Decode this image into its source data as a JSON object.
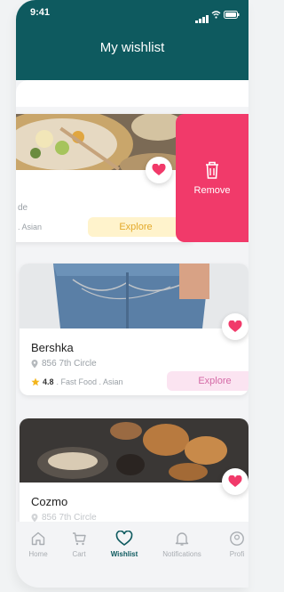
{
  "status_bar": {
    "time": "9:41"
  },
  "header": {
    "title": "My wishlist"
  },
  "cards": [
    {
      "name_partial": "de",
      "meta_partial": ". Asian",
      "explore_label": "Explore",
      "remove_label": "Remove"
    },
    {
      "name": "Bershka",
      "address": "856 7th Circle",
      "rating": "4.8",
      "categories": ". Fast Food . Asian",
      "explore_label": "Explore"
    },
    {
      "name": "Cozmo",
      "address": "856 7th Circle"
    }
  ],
  "nav": {
    "items": [
      {
        "label": "Home",
        "icon": "home-icon"
      },
      {
        "label": "Cart",
        "icon": "cart-icon"
      },
      {
        "label": "Wishlist",
        "icon": "heart-outline-icon",
        "active": true
      },
      {
        "label": "Notifications",
        "icon": "bell-icon"
      },
      {
        "label": "Profi",
        "icon": "profile-icon"
      }
    ]
  },
  "colors": {
    "header": "#0e5a5f",
    "accent": "#f13a6a",
    "explore_yellow_bg": "#fff3cc",
    "explore_yellow_text": "#e3a92a",
    "explore_pink_bg": "#fbe4f1",
    "explore_pink_text": "#d46aa6"
  }
}
